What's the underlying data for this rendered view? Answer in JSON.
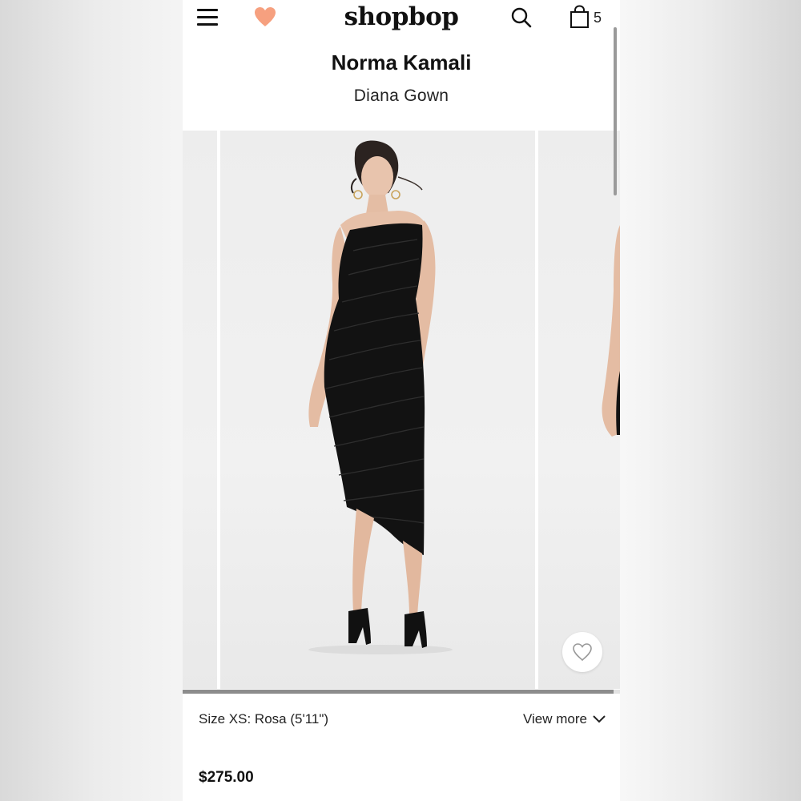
{
  "header": {
    "logo": "shopbop",
    "menu_icon": "hamburger-menu-icon",
    "favorites_icon": "heart-icon",
    "favorites_color": "#f6a07f",
    "search_icon": "search-icon",
    "bag_icon": "shopping-bag-icon",
    "bag_count": "5"
  },
  "product": {
    "brand": "Norma Kamali",
    "name": "Diana Gown",
    "price": "$275.00"
  },
  "gallery": {
    "slides": [
      "previous-image",
      "main-image",
      "next-image"
    ],
    "current_index": 1,
    "progress": 0.985,
    "favorite_button_icon": "heart-outline-icon"
  },
  "size": {
    "info": "Size XS: Rosa (5'11\")",
    "view_more_label": "View more",
    "view_more_icon": "chevron-down-icon"
  },
  "colors": {
    "accent_heart": "#f6a07f",
    "text": "#111111",
    "dress": "#111111"
  }
}
